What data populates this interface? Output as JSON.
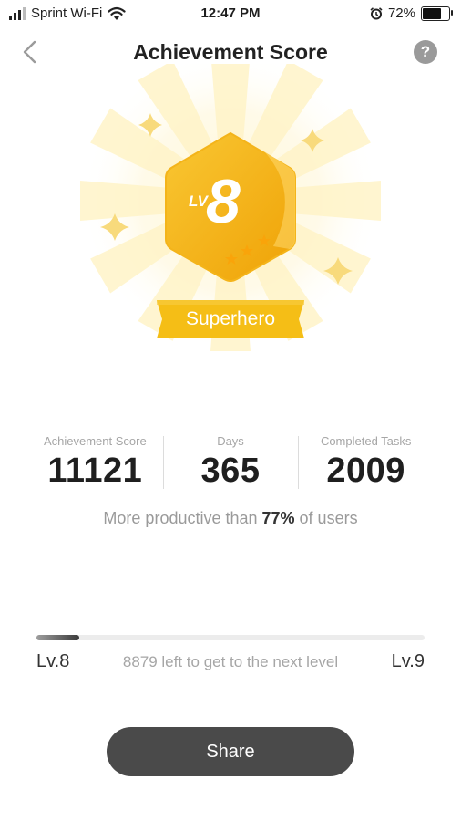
{
  "status_bar": {
    "carrier": "Sprint Wi-Fi",
    "time": "12:47 PM",
    "battery": "72%",
    "battery_level": 0.72,
    "icons": [
      "signal-icon",
      "wifi-icon",
      "alarm-icon",
      "battery-icon"
    ]
  },
  "header": {
    "title": "Achievement Score",
    "back_icon": "chevron-left-icon",
    "help_label": "?"
  },
  "badge": {
    "level_prefix": "LV",
    "level": "8",
    "stars": 3,
    "rank": "Superhero",
    "colors": {
      "gold": "#F6B911",
      "gold_dark": "#EFA206",
      "ray": "#FFF4C8"
    }
  },
  "stats": [
    {
      "label": "Achievement Score",
      "value": "11121"
    },
    {
      "label": "Days",
      "value": "365"
    },
    {
      "label": "Completed Tasks",
      "value": "2009"
    }
  ],
  "productivity": {
    "prefix": "More productive than ",
    "percent": "77%",
    "suffix": " of users"
  },
  "progress": {
    "current_level": "Lv.8",
    "next_level": "Lv.9",
    "remaining_text": "8879 left to get to the next level",
    "fraction": 0.11
  },
  "share_label": "Share"
}
